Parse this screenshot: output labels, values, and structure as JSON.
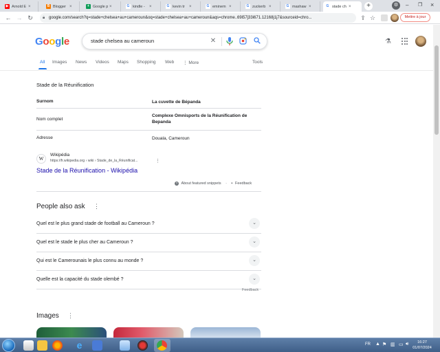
{
  "browser": {
    "tabs": [
      {
        "title": "Arnold E",
        "favicon": "youtube-icon",
        "color": "#ff0000"
      },
      {
        "title": "Blogger",
        "favicon": "blogger-icon",
        "color": "#f57c00"
      },
      {
        "title": "Google p",
        "favicon": "sheets-icon",
        "color": "#0f9d58"
      },
      {
        "title": "kindle -",
        "favicon": "google-icon",
        "color": "#4285f4"
      },
      {
        "title": "kevin tr",
        "favicon": "google-icon",
        "color": "#4285f4"
      },
      {
        "title": "eminem",
        "favicon": "google-icon",
        "color": "#4285f4"
      },
      {
        "title": "zuckerb",
        "favicon": "google-icon",
        "color": "#4285f4"
      },
      {
        "title": "mashaw",
        "favicon": "google-icon",
        "color": "#4285f4"
      },
      {
        "title": "stade ch",
        "favicon": "google-icon",
        "color": "#4285f4"
      }
    ],
    "url": "google.com/search?q=stade+chelsea+au+cameroun&oq=stade+chelsea+au+cameroun&aqs=chrome..69i57j33i671.12168j1j7&sourceid=chro...",
    "update_button": "Mettre à jour"
  },
  "google": {
    "logo": [
      "G",
      "o",
      "o",
      "g",
      "l",
      "e"
    ],
    "query": "stade chelsea au cameroun",
    "tabs": [
      "All",
      "Images",
      "News",
      "Videos",
      "Maps",
      "Shopping",
      "Web",
      "More"
    ],
    "tools": "Tools"
  },
  "snippet": {
    "title": "Stade de la Réunification",
    "rows": [
      {
        "key": "Surnom",
        "value": "La cuvette de Bépanda"
      },
      {
        "key": "Nom complet",
        "value": "Complexe Omnisports de la Réunification de Bepanda"
      },
      {
        "key": "Adresse",
        "value": "Douala, Cameroun"
      }
    ],
    "source_name": "Wikipédia",
    "source_url": "https://fr.wikipedia.org › wiki › Stade_de_la_Réunificat...",
    "link_text": "Stade de la Réunification - Wikipédia",
    "about": "About featured snippets",
    "feedback": "Feedback"
  },
  "paa": {
    "title": "People also ask",
    "questions": [
      "Quel est le plus grand stade de football au Cameroun ?",
      "Quel est le stade le plus cher au Cameroun ?",
      "Qui est le Camerounais le plus connu au monde ?",
      "Quelle est la capacité du stade olembé ?"
    ],
    "feedback": "Feedback"
  },
  "images": {
    "title": "Images"
  },
  "taskbar": {
    "lang": "FR",
    "time": "16:27",
    "date": "01/07/2024"
  }
}
